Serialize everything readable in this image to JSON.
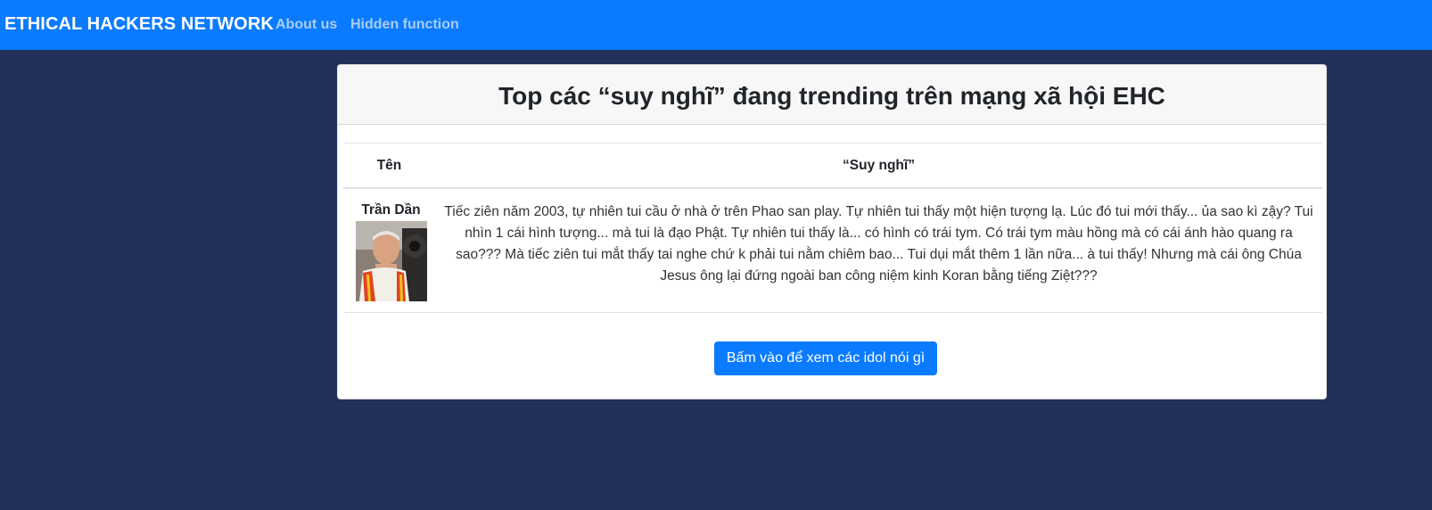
{
  "navbar": {
    "brand": "ETHICAL HACKERS NETWORK",
    "links": [
      "About us",
      "Hidden function"
    ],
    "background_color": "#0a7bff",
    "link_color": "#a9cdf5"
  },
  "page_background": "#24305c",
  "card": {
    "title": "Top các “suy nghĩ” đang trending trên mạng xã hội EHC",
    "table": {
      "headers": [
        "Tên",
        "“Suy nghĩ”"
      ],
      "rows": [
        {
          "name": "Trần Dần",
          "avatar_icon": "person-avatar",
          "thought": "Tiếc ziên năm 2003, tự nhiên tui cầu ở nhà ở trên Phao san play. Tự nhiên tui thấy một hiện tượng lạ. Lúc đó tui mới thấy... ủa sao kì zậy? Tui nhìn 1 cái hình tượng... mà tui là đạo Phật. Tự nhiên tui thấy là... có hình có trái tym. Có trái tym màu hồng mà có cái ánh hào quang ra sao??? Mà tiếc ziên tui mắt thấy tai nghe chứ k phải tui nằm chiêm bao... Tui dụi mắt thêm 1 lần nữa... à tui thấy! Nhưng mà cái ông Chúa Jesus ông lại đứng ngoài ban công niệm kinh Koran bằng tiếng Ziệt???"
        }
      ]
    },
    "button_label": "Bấm vào để xem các idol nói gì"
  }
}
